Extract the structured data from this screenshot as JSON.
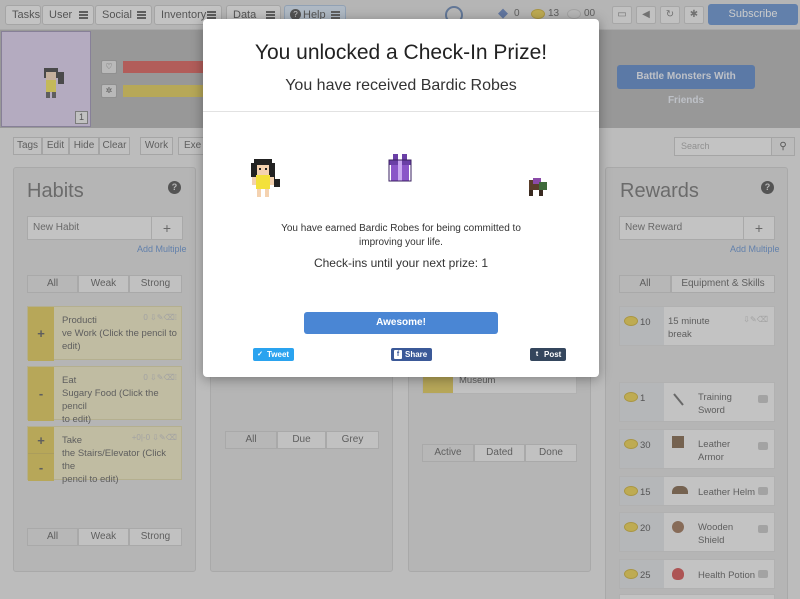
{
  "nav": {
    "items": [
      {
        "label": "Tasks"
      },
      {
        "label": "User"
      },
      {
        "label": "Social"
      },
      {
        "label": "Inventory"
      },
      {
        "label": "Data"
      },
      {
        "label": "Help"
      }
    ],
    "gems": "0",
    "gold": "13",
    "silver": "00",
    "subscribe": "Subscribe"
  },
  "header": {
    "level": "1",
    "battle_button": "Battle Monsters With Friends",
    "health_color": "#d9534f",
    "exp_color": "#e5c32a"
  },
  "filters": {
    "buttons": [
      "Tags",
      "Edit",
      "Hide",
      "Clear",
      "Work",
      "Exe"
    ],
    "search_placeholder": "Search"
  },
  "habits": {
    "title": "Habits",
    "new_placeholder": "New Habit",
    "add_multiple": "Add Multiple",
    "tabs": [
      "All",
      "Weak",
      "Strong"
    ],
    "items": [
      {
        "line1": "Producti",
        "line2": "ve Work (Click the pencil to",
        "line3": "edit)"
      },
      {
        "line1": "Eat",
        "line2": "Sugary Food (Click the pencil",
        "line3": "to edit)"
      },
      {
        "line1": "Take",
        "line2": "the Stairs/Elevator (Click the",
        "line3": "pencil to edit)"
      }
    ],
    "tabs_bottom": [
      "All",
      "Weak",
      "Strong"
    ]
  },
  "dailies": {
    "tabs": [
      "All",
      "Due",
      "Grey"
    ]
  },
  "todos": {
    "item_label": "Museum",
    "tabs": [
      "Active",
      "Dated",
      "Done"
    ]
  },
  "rewards": {
    "title": "Rewards",
    "new_placeholder": "New Reward",
    "add_multiple": "Add Multiple",
    "tabs": [
      "All",
      "Equipment & Skills"
    ],
    "items": [
      {
        "price": "10",
        "name": "15 minute",
        "name2": "break"
      },
      {
        "price": "1",
        "name": "Training",
        "name2": "Sword"
      },
      {
        "price": "30",
        "name": "Leather",
        "name2": "Armor"
      },
      {
        "price": "15",
        "name": "Leather Helm",
        "name2": ""
      },
      {
        "price": "20",
        "name": "Wooden",
        "name2": "Shield"
      },
      {
        "price": "25",
        "name": "Health Potion",
        "name2": ""
      }
    ]
  },
  "modal": {
    "title": "You unlocked a Check-In Prize!",
    "subtitle": "You have received Bardic Robes",
    "earned_line1": "You have earned Bardic Robes for being committed to",
    "earned_line2": "improving your life.",
    "checkins": "Check-ins until your next prize: 1",
    "awesome": "Awesome!",
    "tweet": "Tweet",
    "share": "Share",
    "post": "Post",
    "tweet_color": "#2aa3ef",
    "share_color": "#3b5998",
    "post_color": "#34465d"
  }
}
